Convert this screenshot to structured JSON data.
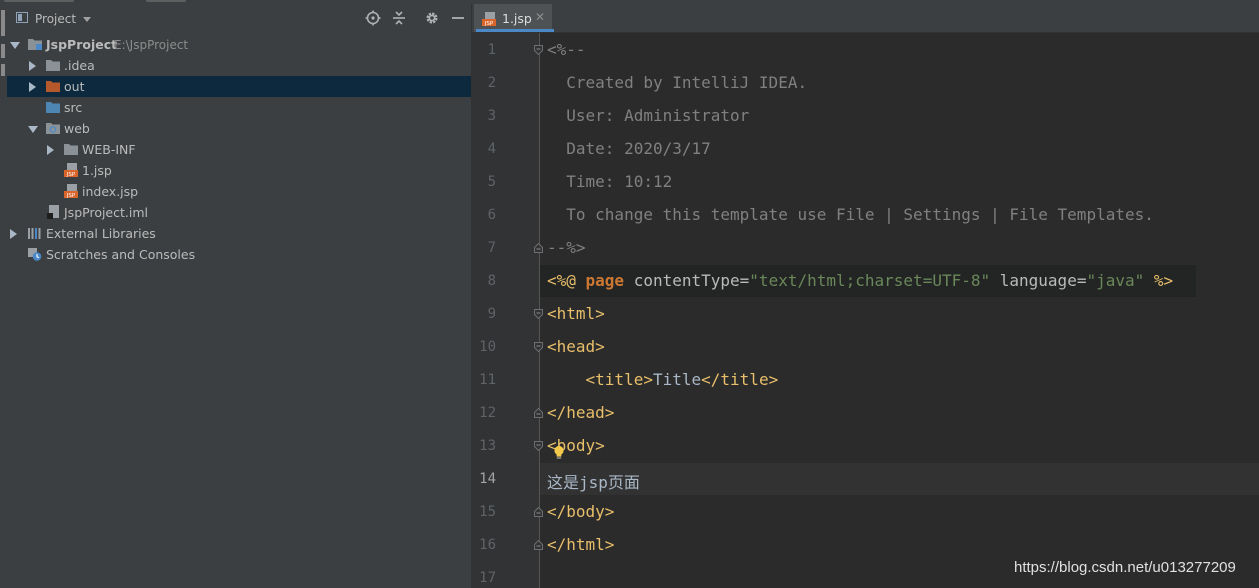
{
  "colors": {
    "panel_bg": "#3c3f41",
    "editor_bg": "#2b2b2b",
    "selection": "#0d293e",
    "folder_gray": "#8a9298",
    "folder_orange": "#b5592d",
    "jsp_orange": "#d9652b",
    "tag_yellow": "#e8bf6a",
    "keyword_orange": "#cc7832",
    "string_green": "#6a8759",
    "comment_gray": "#808080",
    "text": "#a9b7c6"
  },
  "project_panel": {
    "title": "Project",
    "header_icons": [
      "locate-icon",
      "collapse-all-icon",
      "gear-icon",
      "hide-icon"
    ],
    "tree": [
      {
        "label": "JspProject",
        "path": "E:\\JspProject",
        "expanded": true,
        "icon": "module-folder-icon"
      },
      {
        "label": ".idea",
        "expanded": false,
        "icon": "folder-icon"
      },
      {
        "label": "out",
        "expanded": false,
        "icon": "excluded-folder-icon",
        "selected": true
      },
      {
        "label": "src",
        "icon": "source-folder-icon"
      },
      {
        "label": "web",
        "expanded": true,
        "icon": "web-folder-icon"
      },
      {
        "label": "WEB-INF",
        "expanded": false,
        "icon": "folder-icon"
      },
      {
        "label": "1.jsp",
        "icon": "jsp-file-icon"
      },
      {
        "label": "index.jsp",
        "icon": "jsp-file-icon"
      },
      {
        "label": "JspProject.iml",
        "icon": "iml-file-icon"
      },
      {
        "label": "External Libraries",
        "expanded": false,
        "icon": "libraries-icon"
      },
      {
        "label": "Scratches and Consoles",
        "icon": "scratches-icon"
      }
    ]
  },
  "editor": {
    "tab": {
      "label": "1.jsp",
      "close": "✕"
    },
    "current_line": 14,
    "line_numbers": [
      "1",
      "2",
      "3",
      "4",
      "5",
      "6",
      "7",
      "8",
      "9",
      "10",
      "11",
      "12",
      "13",
      "14",
      "15",
      "16",
      "17"
    ],
    "lines": {
      "l1": "<%--",
      "l2": "  Created by IntelliJ IDEA.",
      "l3": "  User: Administrator",
      "l4": "  Date: 2020/3/17",
      "l5": "  Time: 10:12",
      "l6": "  To change this template use File | Settings | File Templates.",
      "l7": "--%>",
      "l8_open": "<%@ ",
      "l8_kw": "page",
      "l8_attr1": " contentType=",
      "l8_val1": "\"text/html;charset=UTF-8\"",
      "l8_attr2": " language=",
      "l8_val2": "\"java\"",
      "l8_close": " %>",
      "l9": "<html>",
      "l10": "<head>",
      "l11_indent": "    ",
      "l11_open": "<title>",
      "l11_text": "Title",
      "l11_close": "</title>",
      "l12": "</head>",
      "l13": "<body>",
      "l14": "这是jsp页面",
      "l15": "</body>",
      "l16": "</html>"
    }
  },
  "watermark": "https://blog.csdn.net/u013277209"
}
